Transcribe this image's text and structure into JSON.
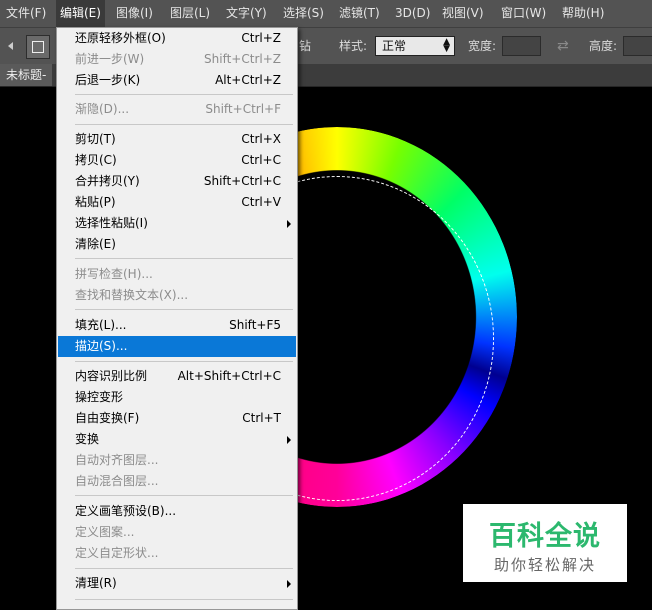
{
  "menubar": {
    "items": [
      "文件(F)",
      "编辑(E)",
      "图像(I)",
      "图层(L)",
      "文字(Y)",
      "选择(S)",
      "滤镜(T)",
      "3D(D)",
      "视图(V)",
      "窗口(W)",
      "帮助(H)"
    ],
    "open_item": "编辑(E)"
  },
  "options_bar": {
    "partial_text": "钻",
    "style_label": "样式:",
    "style_value": "正常",
    "width_label": "宽度:",
    "height_label": "高度:"
  },
  "document_tab": {
    "title": "未标题-"
  },
  "edit_menu": {
    "items": [
      {
        "label": "还原轻移外框(O)",
        "shortcut": "Ctrl+Z",
        "enabled": true
      },
      {
        "label": "前进一步(W)",
        "shortcut": "Shift+Ctrl+Z",
        "enabled": false
      },
      {
        "label": "后退一步(K)",
        "shortcut": "Alt+Ctrl+Z",
        "enabled": true
      },
      {
        "label": "渐隐(D)...",
        "shortcut": "Shift+Ctrl+F",
        "enabled": false
      },
      {
        "label": "剪切(T)",
        "shortcut": "Ctrl+X",
        "enabled": true
      },
      {
        "label": "拷贝(C)",
        "shortcut": "Ctrl+C",
        "enabled": true
      },
      {
        "label": "合并拷贝(Y)",
        "shortcut": "Shift+Ctrl+C",
        "enabled": true
      },
      {
        "label": "粘贴(P)",
        "shortcut": "Ctrl+V",
        "enabled": true
      },
      {
        "label": "选择性粘贴(I)",
        "shortcut": "",
        "enabled": true,
        "submenu": true
      },
      {
        "label": "清除(E)",
        "shortcut": "",
        "enabled": true
      },
      {
        "label": "拼写检查(H)...",
        "shortcut": "",
        "enabled": false
      },
      {
        "label": "查找和替换文本(X)...",
        "shortcut": "",
        "enabled": false
      },
      {
        "label": "填充(L)...",
        "shortcut": "Shift+F5",
        "enabled": true
      },
      {
        "label": "描边(S)...",
        "shortcut": "",
        "enabled": true,
        "highlighted": true
      },
      {
        "label": "内容识别比例",
        "shortcut": "Alt+Shift+Ctrl+C",
        "enabled": true
      },
      {
        "label": "操控变形",
        "shortcut": "",
        "enabled": true
      },
      {
        "label": "自由变换(F)",
        "shortcut": "Ctrl+T",
        "enabled": true
      },
      {
        "label": "变换",
        "shortcut": "",
        "enabled": true,
        "submenu": true
      },
      {
        "label": "自动对齐图层...",
        "shortcut": "",
        "enabled": false
      },
      {
        "label": "自动混合图层...",
        "shortcut": "",
        "enabled": false
      },
      {
        "label": "定义画笔预设(B)...",
        "shortcut": "",
        "enabled": true
      },
      {
        "label": "定义图案...",
        "shortcut": "",
        "enabled": false
      },
      {
        "label": "定义自定形状...",
        "shortcut": "",
        "enabled": false
      },
      {
        "label": "清理(R)",
        "shortcut": "",
        "enabled": true,
        "submenu": true
      }
    ]
  },
  "watermark": {
    "title": "百科全说",
    "subtitle": "助你轻松解决"
  },
  "colors": {
    "ui_gray": "#535353",
    "menu_bg": "#f0f0f0",
    "highlight": "#0a78d7",
    "watermark_green": "#2cb86e"
  }
}
